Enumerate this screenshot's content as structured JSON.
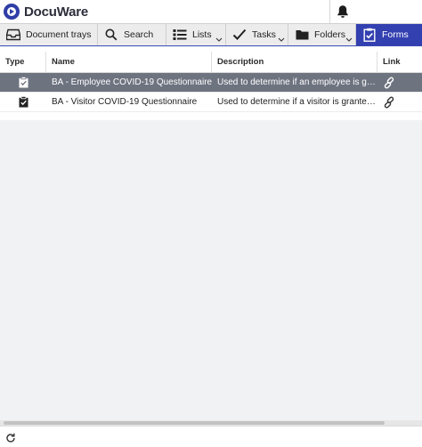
{
  "app": {
    "brand": "DocuWare"
  },
  "tabs": [
    {
      "label": "Document trays",
      "icon": "tray-icon",
      "active": false
    },
    {
      "label": "Search",
      "icon": "search-icon",
      "active": false
    },
    {
      "label": "Lists",
      "icon": "list-icon",
      "active": false,
      "dropdown": true
    },
    {
      "label": "Tasks",
      "icon": "checkmark-icon",
      "active": false,
      "dropdown": true
    },
    {
      "label": "Folders",
      "icon": "folder-icon",
      "active": false,
      "dropdown": true
    },
    {
      "label": "Forms",
      "icon": "clipboard-check-icon",
      "active": true
    }
  ],
  "table": {
    "columns": [
      "Type",
      "Name",
      "Description",
      "Link"
    ],
    "rows": [
      {
        "name": "BA - Employee COVID-19 Questionnaire",
        "description": "Used to determine if an employee is granted access",
        "selected": true
      },
      {
        "name": "BA - Visitor COVID-19 Questionnaire",
        "description": "Used to determine if a visitor is granted access",
        "selected": false
      }
    ]
  },
  "colors": {
    "accent": "#3340b0",
    "selected_row": "#6e7380",
    "tabbar": "#ececec",
    "empty_area": "#f1f2f3"
  }
}
